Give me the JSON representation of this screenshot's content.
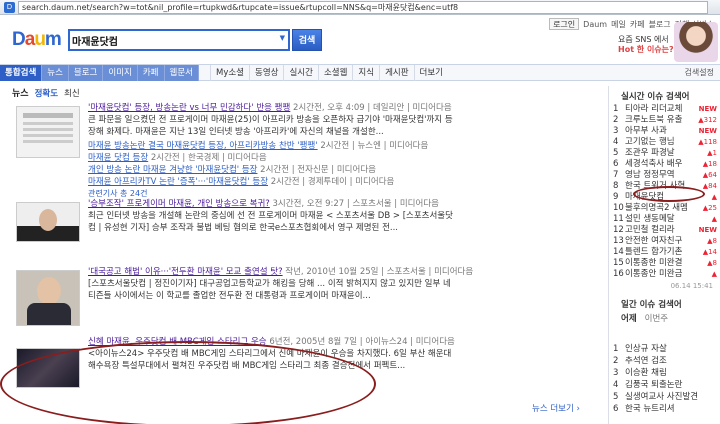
{
  "browser": {
    "url": "search.daum.net/search?w=tot&nil_profile=rtupkwd&rtupcate=issue&rtupcoll=NNS&q=마재윤닷컴&enc=utf8"
  },
  "util": {
    "login": "로그인",
    "links": [
      "Daum",
      "메일",
      "카페",
      "블로그"
    ],
    "all": "전체 서비스"
  },
  "logo": {
    "text": "Daum"
  },
  "search": {
    "value": "마재윤닷컴",
    "button": "검색"
  },
  "promo": {
    "line1": "요즘 SNS 에서",
    "line2": "Hot 한 이슈는?"
  },
  "nav": {
    "tabs": [
      "통합검색",
      "뉴스",
      "블로그",
      "이미지",
      "카페",
      "웹문서"
    ],
    "more": [
      "My소셜",
      "동영상",
      "실시간",
      "소셜웹",
      "지식",
      "게시판",
      "더보기"
    ],
    "setting": "검색설정"
  },
  "news": {
    "header": "뉴스",
    "sort": [
      "정확도",
      "최신"
    ],
    "more": "뉴스 더보기 ›",
    "items": [
      {
        "title": "'마재윤닷컴' 등장, 방송논란 vs 너무 민감하다' 반응 팽팽",
        "meta": "2시간전, 오후 4:09 | 데일리안 | 미디어다음",
        "desc": [
          "큰 파문을 일으켰던 전 프로게이머 마재윤(25)이 아프리카 방송을 오픈하자 급기야 '마재윤닷컴'까지 등",
          "장해 화제다. 마재윤은 지난 13일 인터넷 방송 '아프리카'에 자신의 채널을 개설한..."
        ],
        "subs": [
          {
            "title": "마재윤 방송논란 결국 마재윤닷컴 등장, 아프리카방송 찬반 '팽팽'",
            "meta": "2시간전 | 뉴스엔 | 미디어다음"
          },
          {
            "title": "마재윤 닷컴 등장",
            "meta": "2시간전 | 한국경제 | 미디어다음"
          },
          {
            "title": "개인 방송 논란 마재윤 겨냥한 '마재윤닷컴' 등장",
            "meta": "2시간전 | 전자신문 | 미디어다음"
          },
          {
            "title": "마재윤 아프리카TV 논란 '증폭'···'마재윤닷컴' 등장",
            "meta": "2시간전 | 경제투데이 | 미디어다음"
          }
        ],
        "related": "관련기사 총 24건"
      },
      {
        "title": "'승부조작' 프로게이머 마재윤, 개인 방송으로 복귀?",
        "meta": "3시간전, 오전 9:27 | 스포츠서울 | 미디어다음",
        "desc": [
          "최근 인터넷 방송을 개설해 논란의 중심에 선 전 프로게이머 마재윤 < 스포츠서울 DB > [스포츠서울닷",
          "컴 | 유성현 기자] 승부 조작과 불법 베팅 혐의로 한국e스포츠협회에서 영구 제명된 전..."
        ]
      },
      {
        "title": "'대국공고 해법' 이유···'전두환 마재윤' 모교 출연설 탓?",
        "meta": "작년, 2010년 10월 25일 | 스포츠서울 | 미디어다음",
        "desc": [
          "[스포츠서울닷컴 | 정진이기자] 대구공업고등학교가 해킹을 당해 ... 이적 밝혀지지 않고 있지만 일부 네",
          "티즌들 사이에서는 이 학교를 졸업한 전두환 전 대통령과 프로게이머 마재윤이..."
        ]
      },
      {
        "title": "신혜 마재윤, 우주닷컴 배 MBC게임 스타리그 우승",
        "meta": "6년전, 2005년 8월 7일 | 아이뉴스24 | 미디어다음",
        "desc": [
          "<아이뉴스24> 우주닷컴 배 MBC게임 스타리그에서 신예 마재윤이 우승을 차지했다. 6일 부산 해운대",
          "해수욕장 특설무대에서 펼쳐진 우주닷컴 배 MBC게임 스타리그 최종 결승전에서 퍼펙트..."
        ]
      }
    ]
  },
  "sidebar": {
    "title": "실시간 이슈 검색어",
    "items": [
      {
        "n": "1",
        "w": "티아라 리더교체",
        "b": "NEW"
      },
      {
        "n": "2",
        "w": "크루노트북 유출",
        "b": "▲312"
      },
      {
        "n": "3",
        "w": "아무부 사과",
        "b": "NEW"
      },
      {
        "n": "4",
        "w": "고기없는 행님",
        "b": "▲118"
      },
      {
        "n": "5",
        "w": "조관우 파경날",
        "b": "▲1"
      },
      {
        "n": "6",
        "w": "세경석축사 배우",
        "b": "▲18"
      },
      {
        "n": "7",
        "w": "영남 정정무역",
        "b": "▲64"
      },
      {
        "n": "8",
        "w": "한국 트위거 사혁",
        "b": "▲84"
      },
      {
        "n": "9",
        "w": "마재윤닷컴",
        "b": "▲"
      },
      {
        "n": "10",
        "w": "불후의명곡2 새멤",
        "b": "▲25"
      },
      {
        "n": "11",
        "w": "설민 생동메달",
        "b": "▲"
      },
      {
        "n": "12",
        "w": "고민철 컬리라",
        "b": "NEW"
      },
      {
        "n": "13",
        "w": "안전한 여자친구",
        "b": "▲8"
      },
      {
        "n": "14",
        "w": "틀렌드 합가기촌",
        "b": "▲14"
      },
      {
        "n": "15",
        "w": "이통종한 미완결",
        "b": "▲8"
      },
      {
        "n": "16",
        "w": "이통종안 미완금",
        "b": "▲"
      }
    ],
    "time": "06.14 15:41",
    "title2": "일간 이슈 검색어",
    "tabs2": [
      "어제",
      "이번주"
    ],
    "items2": [
      {
        "n": "1",
        "w": "인상규 자살"
      },
      {
        "n": "2",
        "w": "추석연 검조"
      },
      {
        "n": "3",
        "w": "이승환 채림"
      },
      {
        "n": "4",
        "w": "김풍국 퇴출논란"
      },
      {
        "n": "5",
        "w": "실생여교사 사진발견"
      },
      {
        "n": "6",
        "w": "한국 뉴트리셔"
      }
    ]
  }
}
